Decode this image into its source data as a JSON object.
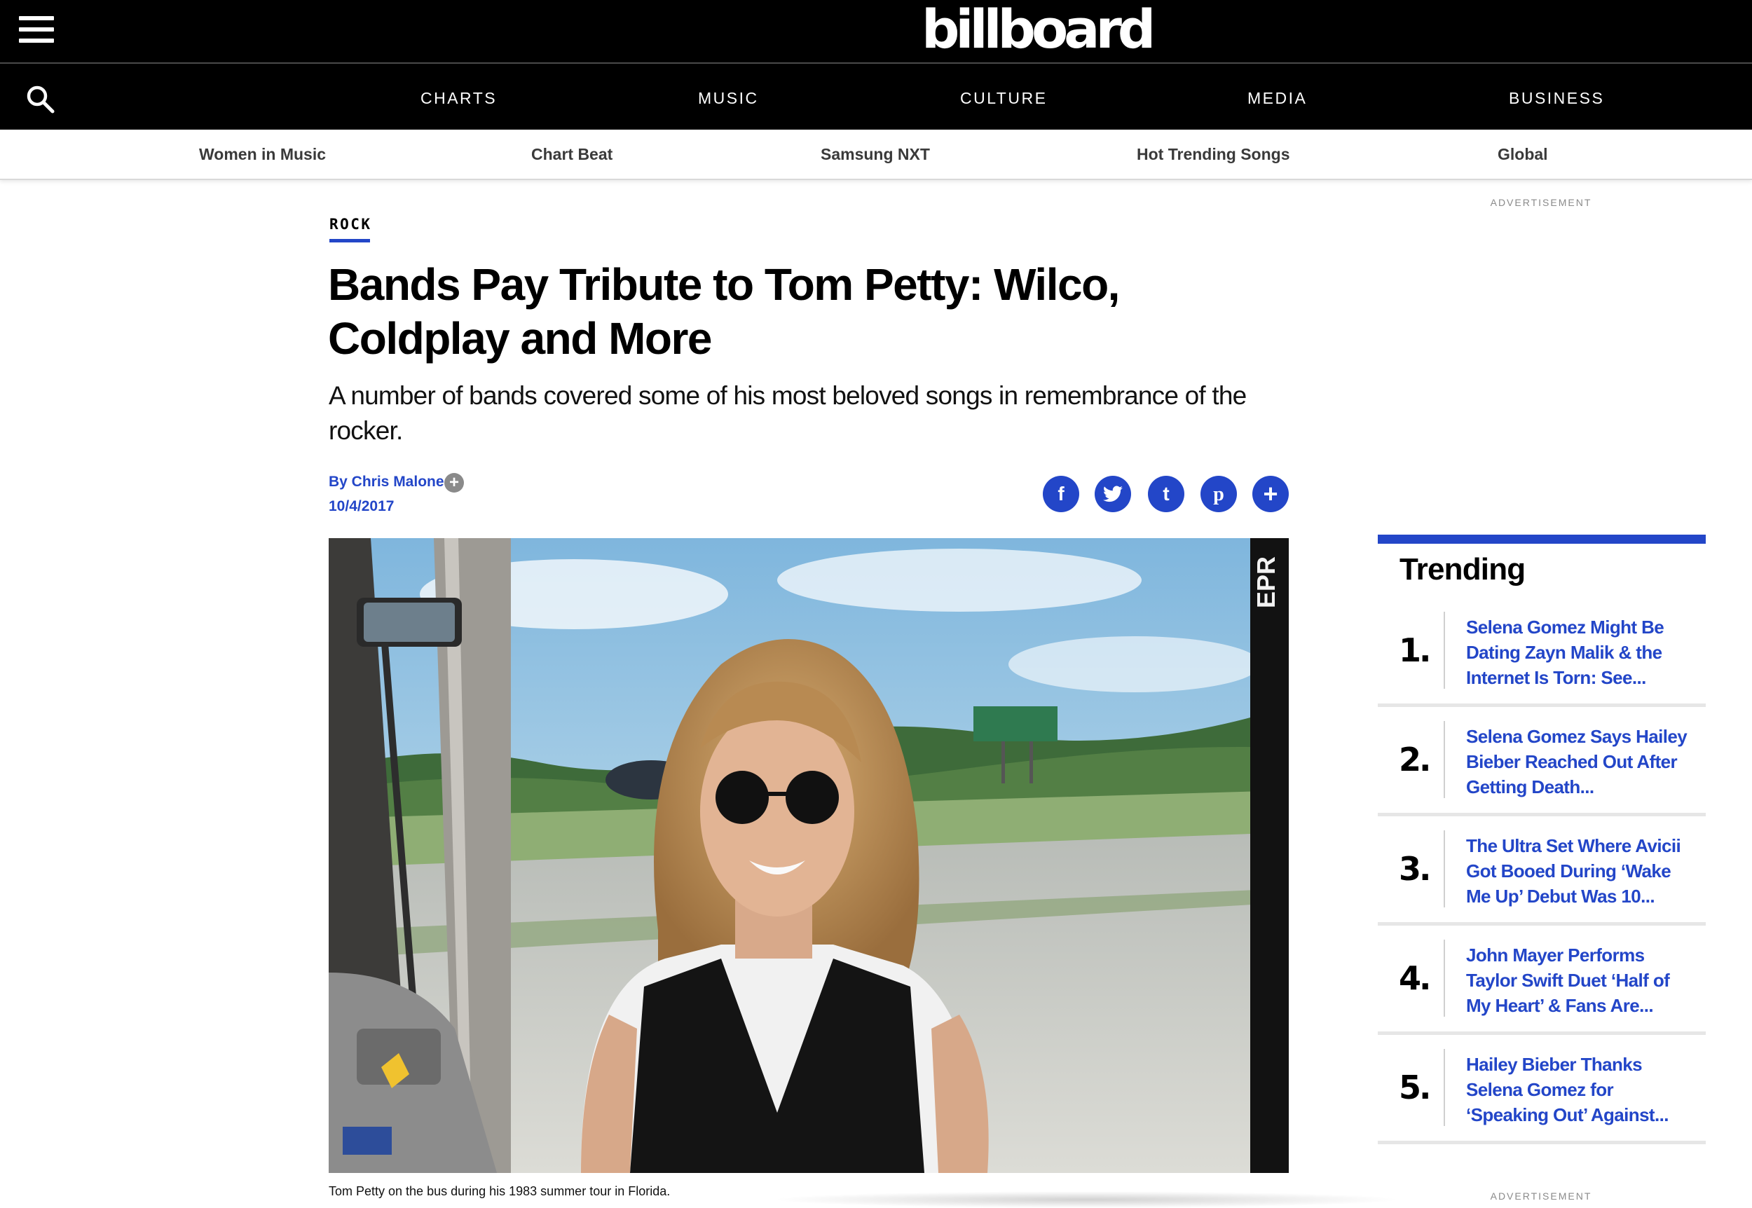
{
  "header": {
    "logo_text": "billboard",
    "main_nav": [
      "CHARTS",
      "MUSIC",
      "CULTURE",
      "MEDIA",
      "BUSINESS"
    ],
    "sub_nav": [
      "Women in Music",
      "Chart Beat",
      "Samsung NXT",
      "Hot Trending Songs",
      "Global"
    ]
  },
  "advertisement_label": "ADVERTISEMENT",
  "article": {
    "category": "ROCK",
    "headline": "Bands Pay Tribute to Tom Petty: Wilco, Coldplay and More",
    "dek": "A number of bands covered some of his most beloved songs in remembrance of the rocker.",
    "byline": "By Chris Malone",
    "date": "10/4/2017",
    "image_caption": "Tom Petty on the bus during his 1983 summer tour in Florida.",
    "share_icons": [
      "facebook-icon",
      "twitter-icon",
      "tumblr-icon",
      "pinterest-icon",
      "plus-icon"
    ]
  },
  "trending": {
    "title": "Trending",
    "items": [
      {
        "rank": "1.",
        "title": "Selena Gomez Might Be Dating Zayn Malik & the Internet Is Torn: See..."
      },
      {
        "rank": "2.",
        "title": "Selena Gomez Says Hailey Bieber Reached Out After Getting Death..."
      },
      {
        "rank": "3.",
        "title": "The Ultra Set Where Avicii Got Booed During ‘Wake Me Up’ Debut Was 10..."
      },
      {
        "rank": "4.",
        "title": "John Mayer Performs Taylor Swift Duet ‘Half of My Heart’ & Fans Are..."
      },
      {
        "rank": "5.",
        "title": "Hailey Bieber Thanks Selena Gomez for ‘Speaking Out’ Against..."
      }
    ]
  },
  "colors": {
    "brand_blue": "#2346c8",
    "header_black": "#000000"
  }
}
